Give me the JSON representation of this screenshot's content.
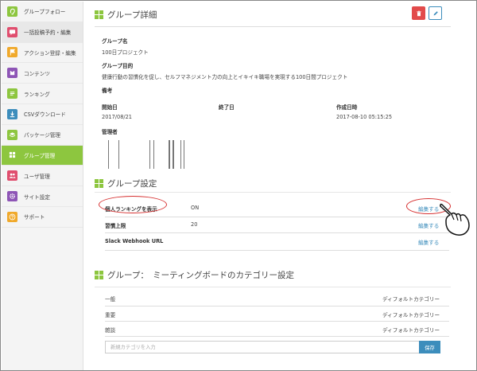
{
  "sidebar": {
    "items": [
      {
        "label": "グループフォロー",
        "icon": "ear-icon",
        "color": "#8dc63f",
        "active": false
      },
      {
        "label": "一括投稿予約・編集",
        "icon": "chat-icon",
        "color": "#e04e6e",
        "active": false
      },
      {
        "label": "アクション登録・編集",
        "icon": "flag-icon",
        "color": "#f0a92b",
        "active": false
      },
      {
        "label": "コンテンツ",
        "icon": "content-icon",
        "color": "#8e55b6",
        "active": false
      },
      {
        "label": "ランキング",
        "icon": "ranking-icon",
        "color": "#8dc63f",
        "active": false
      },
      {
        "label": "CSVダウンロード",
        "icon": "download-icon",
        "color": "#3c8dbc",
        "active": false
      },
      {
        "label": "パッケージ管理",
        "icon": "layers-icon",
        "color": "#8dc63f",
        "active": false
      },
      {
        "label": "グループ管理",
        "icon": "grid-icon",
        "color": "#8dc63f",
        "active": true
      },
      {
        "label": "ユーザ管理",
        "icon": "users-icon",
        "color": "#e04e6e",
        "active": false
      },
      {
        "label": "サイト設定",
        "icon": "gear-icon",
        "color": "#8e55b6",
        "active": false
      },
      {
        "label": "サポート",
        "icon": "question-icon",
        "color": "#f0a92b",
        "active": false
      }
    ]
  },
  "detail": {
    "title": "グループ詳細",
    "group_name_label": "グループ名",
    "group_name": "100日プロジェクト",
    "purpose_label": "グループ目的",
    "purpose": "健康行動の習慣化を促し、セルフマネジメント力の向上とイキイキ職場を実現する100日間プロジェクト",
    "notes_label": "備考",
    "start_label": "開始日",
    "start_value": "2017/08/21",
    "end_label": "終了日",
    "created_label": "作成日時",
    "created_value": "2017-08-10 05:15:25",
    "admin_label": "管理者"
  },
  "settings": {
    "title": "グループ設定",
    "rows": [
      {
        "label": "個人ランキングを表示",
        "value": "ON",
        "action": "編集する"
      },
      {
        "label": "習慣上限",
        "value": "20",
        "action": "編集する"
      },
      {
        "label": "Slack Webhook URL",
        "value": "",
        "action": "編集する"
      }
    ]
  },
  "categories": {
    "title": "グループ：　ミーティングボードのカテゴリー設定",
    "rows": [
      {
        "name": "一般",
        "type": "ディフォルトカテゴリー"
      },
      {
        "name": "重要",
        "type": "ディフォルトカテゴリー"
      },
      {
        "name": "雑談",
        "type": "ディフォルトカテゴリー"
      }
    ],
    "input_placeholder": "新規カテゴリを入力",
    "save_label": "保存"
  },
  "colors": {
    "accent": "#8dc63f",
    "link": "#3c8dbc",
    "danger": "#e24b4b",
    "annotation": "#d62f2f"
  }
}
